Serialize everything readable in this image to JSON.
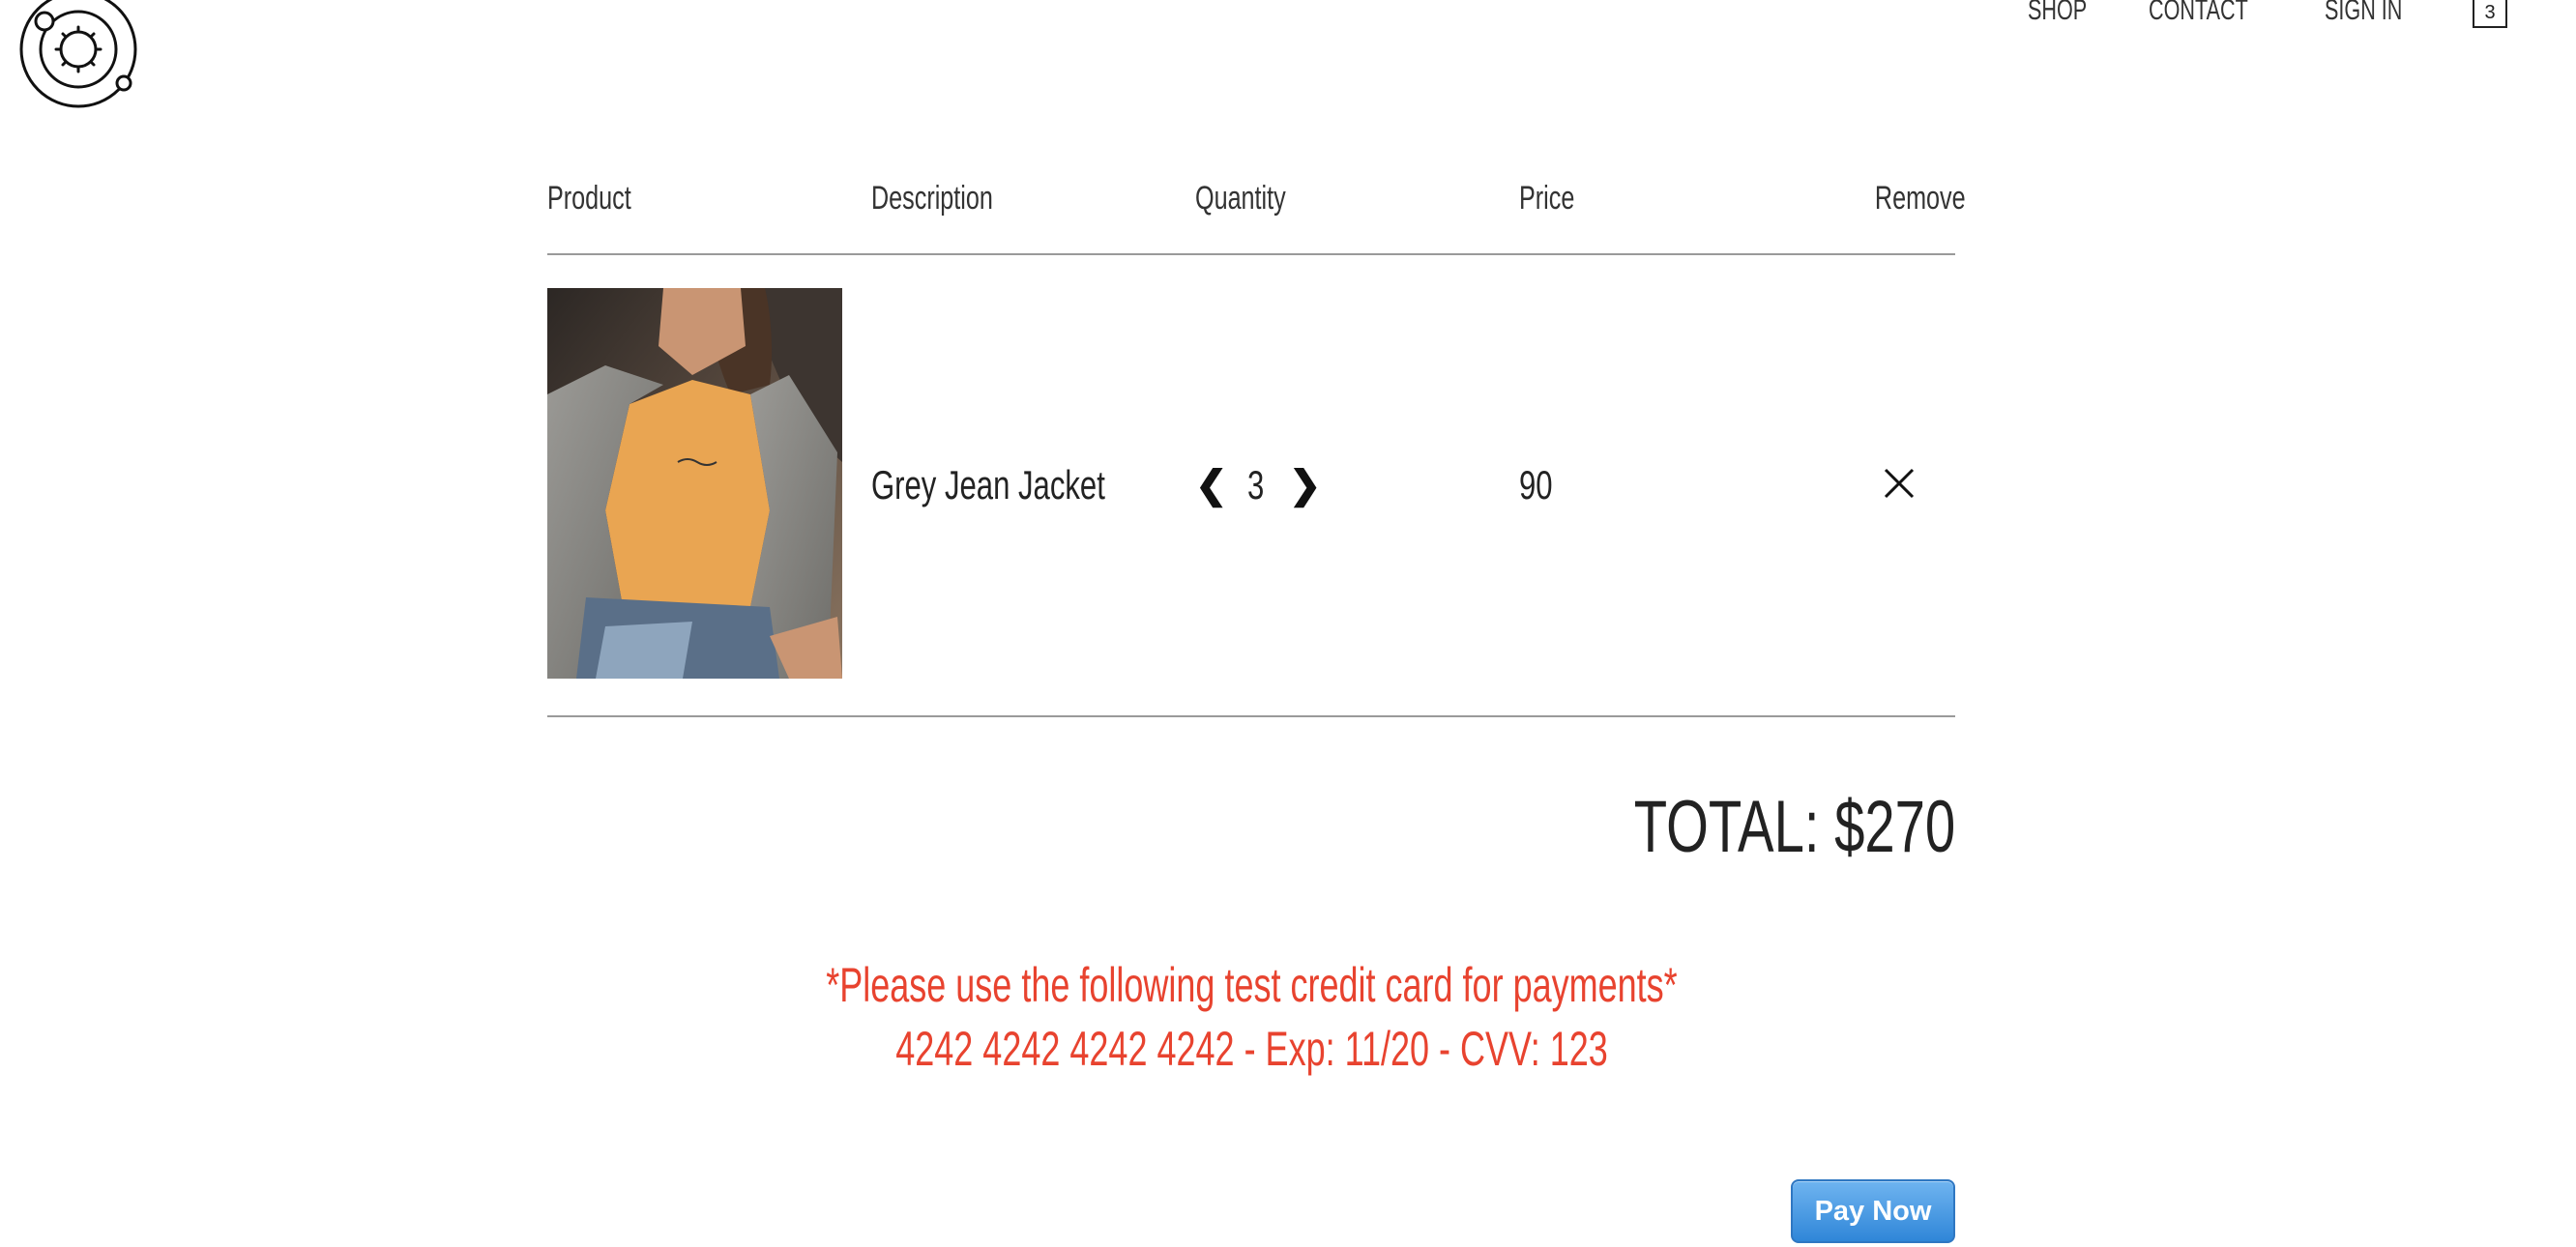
{
  "nav": {
    "shop": "SHOP",
    "contact": "CONTACT",
    "sign_in": "SIGN IN",
    "cart_count": "3"
  },
  "cart": {
    "headers": {
      "product": "Product",
      "description": "Description",
      "quantity": "Quantity",
      "price": "Price",
      "remove": "Remove"
    },
    "items": [
      {
        "name": "Grey Jean Jacket",
        "quantity": "3",
        "price": "90"
      }
    ]
  },
  "total": "TOTAL: $270",
  "notice": {
    "line1": "*Please use the following test credit card for payments*",
    "line2": "4242 4242 4242 4242 - Exp: 11/20 - CVV: 123"
  },
  "pay_button": "Pay Now",
  "colors": {
    "notice": "#e8432f",
    "pay_button": "#3a8fdc",
    "divider": "#9a9a9a"
  }
}
